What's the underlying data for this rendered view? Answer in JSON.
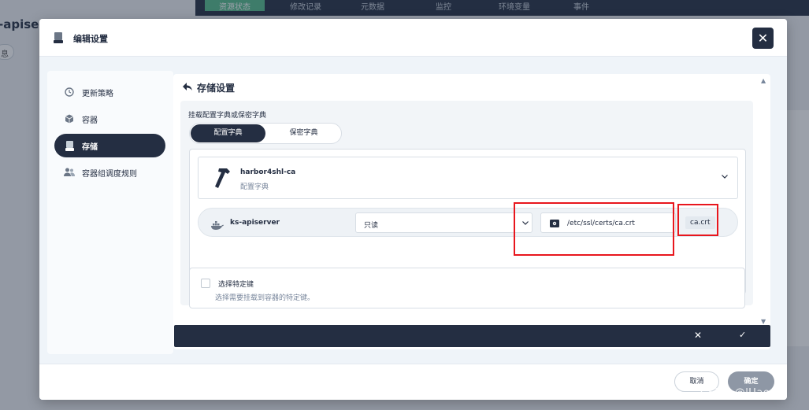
{
  "background": {
    "tabs": [
      "资源状态",
      "修改记录",
      "元数据",
      "监控",
      "环境变量",
      "事件"
    ],
    "title": "-apiser",
    "chip": "息"
  },
  "dialog": {
    "title": "编辑设置",
    "close_symbol": "✕"
  },
  "nav": {
    "items": [
      {
        "label": "更新策略",
        "icon": "clock-icon"
      },
      {
        "label": "容器",
        "icon": "cube-icon"
      },
      {
        "label": "存储",
        "icon": "disk-icon",
        "active": true
      },
      {
        "label": "容器组调度规则",
        "icon": "users-icon"
      }
    ]
  },
  "storage": {
    "title": "存储设置",
    "mount_label": "挂载配置字典或保密字典",
    "segments": {
      "configmap": "配置字典",
      "secret": "保密字典"
    },
    "selected": {
      "name": "harbor4shl-ca",
      "type": "配置字典"
    },
    "mount": {
      "container": "ks-apiserver",
      "access_mode": "只读",
      "path": "/etc/ssl/certs/ca.crt",
      "key": "ca.crt"
    },
    "specific_keys": {
      "label": "选择特定键",
      "description": "选择需要挂载到容器的特定键。"
    },
    "action_cancel": "✕",
    "action_ok": "✓"
  },
  "footer": {
    "cancel": "取消",
    "ok": "确定"
  },
  "watermark": "CSDN @lUaena",
  "colors": {
    "primary_dark": "#242e42",
    "highlight_red": "#e8161d",
    "accent_green": "#55bc8a"
  }
}
